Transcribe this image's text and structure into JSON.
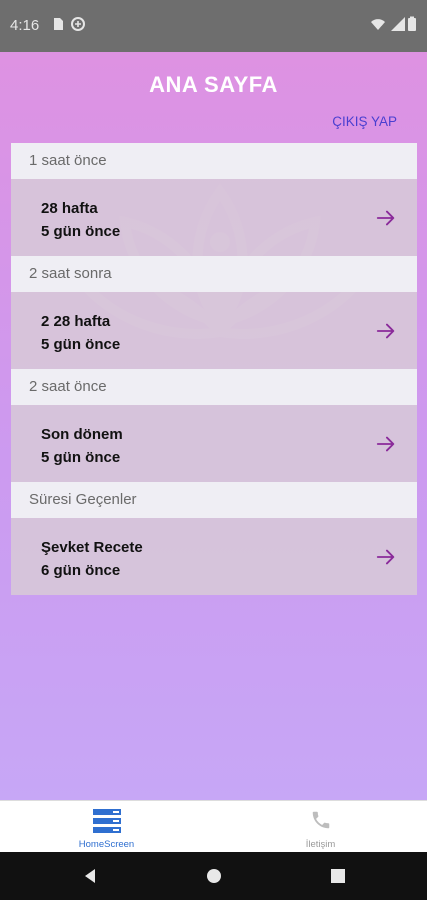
{
  "status_bar": {
    "time": "4:16"
  },
  "header": {
    "title": "ANA SAYFA",
    "logout_label": "ÇIKIŞ YAP"
  },
  "sections": [
    {
      "header": "1 saat önce",
      "item": {
        "title": "28 hafta",
        "subtitle": "5 gün önce"
      }
    },
    {
      "header": "2 saat sonra",
      "item": {
        "title": "2 28 hafta",
        "subtitle": "5 gün önce"
      }
    },
    {
      "header": "2 saat önce",
      "item": {
        "title": "Son dönem",
        "subtitle": "5 gün önce"
      }
    },
    {
      "header": "Süresi Geçenler",
      "item": {
        "title": "Şevket Recete",
        "subtitle": "6 gün önce"
      }
    }
  ],
  "tabs": [
    {
      "label": "HomeScreen",
      "icon": "list-icon",
      "active": true
    },
    {
      "label": "İletişim",
      "icon": "phone-icon",
      "active": false
    }
  ],
  "colors": {
    "accent": "#2f6fd0",
    "arrow": "#8a2a9a",
    "logout": "#4a3fd0"
  }
}
